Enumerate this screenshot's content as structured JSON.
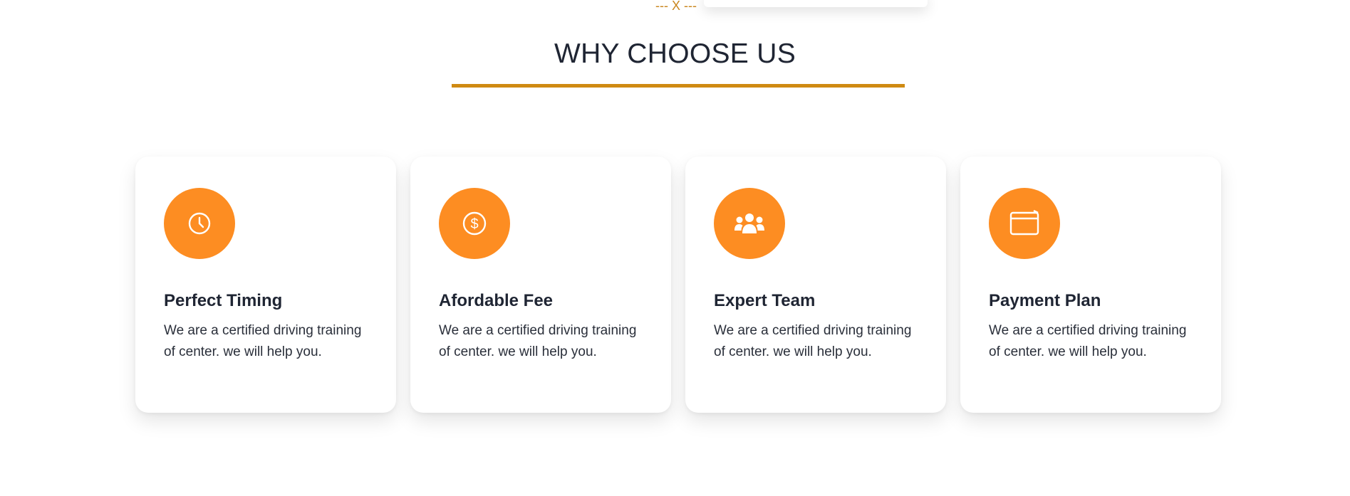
{
  "top": {
    "divider_text": "--- X ---"
  },
  "section": {
    "title": "WHY CHOOSE US",
    "accent_color": "#cf8a12"
  },
  "features": [
    {
      "icon": "clock-icon",
      "title": "Perfect Timing",
      "text": "We are a certified driving training of center. we will help you."
    },
    {
      "icon": "dollar-icon",
      "title": "Afordable Fee",
      "text": "We are a certified driving training of center. we will help you."
    },
    {
      "icon": "team-icon",
      "title": "Expert Team",
      "text": "We are a certified driving training of center. we will help you."
    },
    {
      "icon": "window-icon",
      "title": "Payment Plan",
      "text": "We are a certified driving training of center. we will help you."
    }
  ],
  "colors": {
    "icon_bg": "#fd8d22",
    "heading": "#1f2533"
  }
}
